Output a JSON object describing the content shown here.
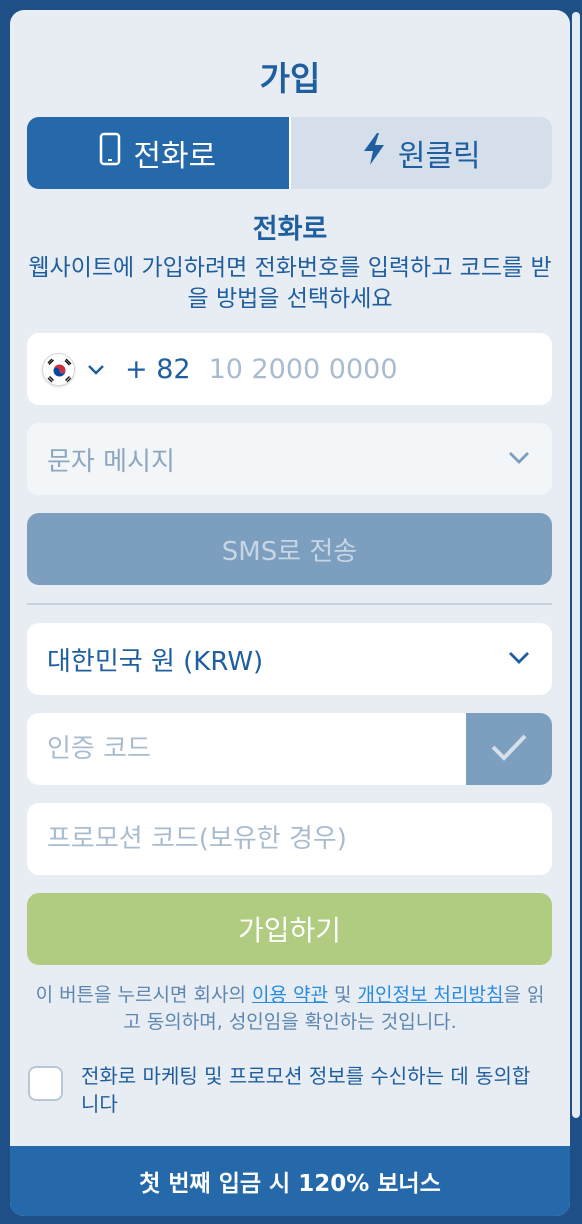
{
  "title": "가입",
  "tabs": [
    {
      "label": "전화로",
      "icon": "phone-icon",
      "active": true
    },
    {
      "label": "원클릭",
      "icon": "lightning-icon",
      "active": false
    }
  ],
  "section_title": "전화로",
  "description": "웹사이트에 가입하려면 전화번호를 입력하고 코드를 받을 방법을 선택하세요",
  "phone": {
    "country_flag": "korea-flag-icon",
    "prefix": "+ 82",
    "placeholder": "10 2000 0000"
  },
  "method_select": {
    "value": "문자 메시지"
  },
  "sms_button": "SMS로 전송",
  "currency_select": {
    "value": "대한민국 원 (KRW)"
  },
  "code_field": {
    "placeholder": "인증 코드"
  },
  "promo_field": {
    "placeholder": "프로모션 코드(보유한 경우)"
  },
  "register_button": "가입하기",
  "terms": {
    "prefix": "이 버튼을 누르시면 회사의 ",
    "terms_link": "이용 약관",
    "and": " 및 ",
    "privacy_link": "개인정보 처리방침",
    "suffix": "을 읽고 동의하며, 성인임을 확인하는 것입니다."
  },
  "consent_text": "전화로 마케팅 및 프로모션 정보를 수신하는 데 동의합니다",
  "bonus_banner": "첫 번째 입금 시 120% 보너스",
  "colors": {
    "primary": "#2669aa",
    "text_blue": "#1f5fa0",
    "disabled_button": "#7c9ebf",
    "register_button": "#b0cc80",
    "background": "#e8edf3",
    "link": "#2a8ce0"
  }
}
